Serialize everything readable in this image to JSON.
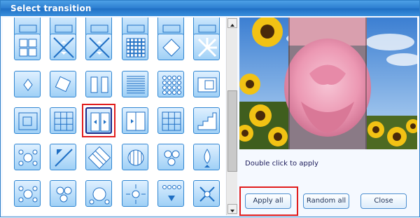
{
  "window": {
    "title": "Select transition"
  },
  "tiles": [
    {
      "icon": "partial-tile-icon"
    },
    {
      "icon": "partial-tile-icon"
    },
    {
      "icon": "partial-tile-icon"
    },
    {
      "icon": "partial-tile-icon"
    },
    {
      "icon": "partial-tile-icon"
    },
    {
      "icon": "partial-tile-icon"
    },
    {
      "icon": "four-squares-icon"
    },
    {
      "icon": "diagonal-split-icon"
    },
    {
      "icon": "diagonal-split-icon"
    },
    {
      "icon": "small-grid-icon"
    },
    {
      "icon": "diamond-icon"
    },
    {
      "icon": "burst-icon"
    },
    {
      "icon": "corner-burst-icon"
    },
    {
      "icon": "rotate-square-icon"
    },
    {
      "icon": "split-doors-icon"
    },
    {
      "icon": "horizontal-lines-icon"
    },
    {
      "icon": "dots-grid-icon"
    },
    {
      "icon": "inset-square-icon"
    },
    {
      "icon": "inset-box-icon"
    },
    {
      "icon": "grid-icon"
    },
    {
      "icon": "open-doors-icon"
    },
    {
      "icon": "close-doors-icon"
    },
    {
      "icon": "grid-icon"
    },
    {
      "icon": "stairs-icon"
    },
    {
      "icon": "circles-out-icon"
    },
    {
      "icon": "arrow-diagonal-icon"
    },
    {
      "icon": "striped-square-icon"
    },
    {
      "icon": "striped-circle-icon"
    },
    {
      "icon": "circles-cluster-icon"
    },
    {
      "icon": "drop-icon"
    },
    {
      "icon": "circles-out-icon"
    },
    {
      "icon": "circles-cluster-icon"
    },
    {
      "icon": "circle-center-icon"
    },
    {
      "icon": "sparkle-icon"
    },
    {
      "icon": "dots-down-icon"
    },
    {
      "icon": "scatter-arrows-icon"
    }
  ],
  "selected_tile_index": 20,
  "preview": {
    "hint": "Double click to apply"
  },
  "buttons": {
    "apply_all": "Apply all",
    "random_all": "Random all",
    "close": "Close"
  },
  "colors": {
    "titlebar": "#2b7dd0",
    "selection": "#e11d1d",
    "tile_border": "#2f86d2"
  }
}
